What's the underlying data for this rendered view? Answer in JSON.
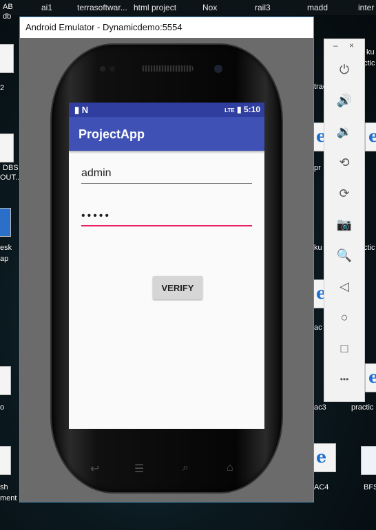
{
  "desktop": {
    "top_labels": [
      "ai1",
      "terrasoftwar...",
      "html project",
      "Nox",
      "rail3",
      "madd",
      "inter"
    ],
    "left_labels": [
      "AB",
      "db",
      "2",
      "DBS",
      "OUT...",
      "esk",
      "ap",
      "o",
      "sh",
      "ment"
    ],
    "right_labels": [
      "ku",
      "ctic",
      "trac",
      "pr",
      "ku",
      "ctic",
      "ac",
      "ac3",
      "practic",
      "AC4",
      "BFS"
    ]
  },
  "window": {
    "title": "Android Emulator - Dynamicdemo:5554"
  },
  "statusbar": {
    "left_icons": "▮ N",
    "signal": "LTE",
    "time": "5:10"
  },
  "app": {
    "title": "ProjectApp",
    "username_value": "admin",
    "password_value": "•••••",
    "verify_label": "VERIFY"
  },
  "toolbar": {
    "minimize": "–",
    "close": "×",
    "buttons": [
      {
        "name": "power-icon",
        "glyph": "⏻"
      },
      {
        "name": "volume-up-icon",
        "glyph": "🔊"
      },
      {
        "name": "volume-down-icon",
        "glyph": "🔉"
      },
      {
        "name": "rotate-left-icon",
        "glyph": "⟲"
      },
      {
        "name": "rotate-right-icon",
        "glyph": "⟳"
      },
      {
        "name": "camera-icon",
        "glyph": "📷"
      },
      {
        "name": "zoom-icon",
        "glyph": "🔍"
      },
      {
        "name": "back-icon",
        "glyph": "◁"
      },
      {
        "name": "home-icon",
        "glyph": "○"
      },
      {
        "name": "overview-icon",
        "glyph": "□"
      },
      {
        "name": "more-icon",
        "glyph": "•••"
      }
    ]
  },
  "colors": {
    "primary": "#3f51b5",
    "primary_dark": "#303f9f",
    "accent": "#e91e63"
  }
}
